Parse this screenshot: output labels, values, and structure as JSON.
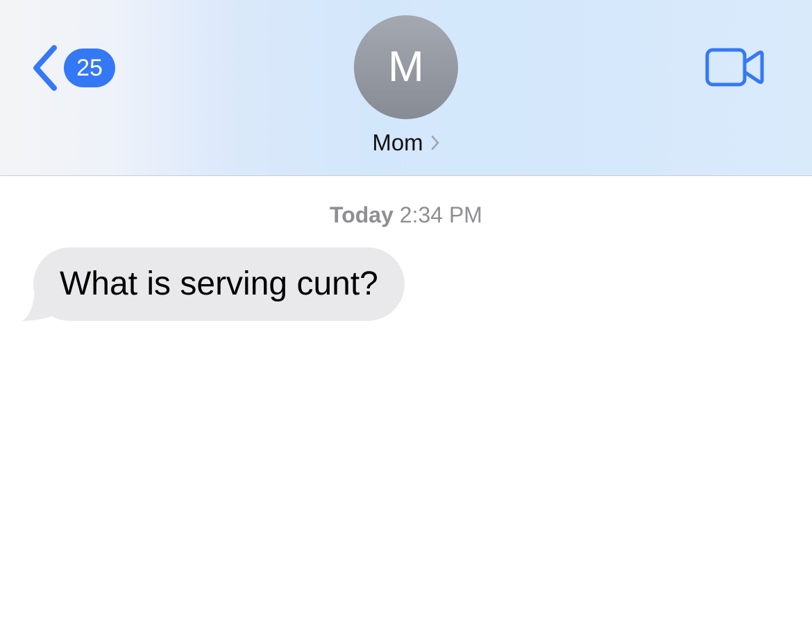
{
  "nav": {
    "back_count": "25",
    "contact_initial": "M",
    "contact_name": "Mom"
  },
  "thread": {
    "timestamp_day": "Today",
    "timestamp_time": "2:34 PM",
    "messages": [
      {
        "direction": "incoming",
        "text": "What is serving cunt?"
      }
    ]
  },
  "colors": {
    "accent": "#3478f6",
    "incoming_bubble": "#e9e9eb",
    "timestamp_text": "#8e8e93"
  }
}
